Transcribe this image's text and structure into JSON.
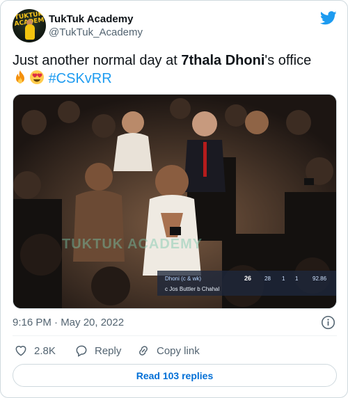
{
  "user": {
    "display_name": "TukTuk Academy",
    "handle": "@TukTuk_Academy",
    "avatar_text": "TUKTUK ACADEMY"
  },
  "tweet": {
    "text_prefix": "Just another normal day at ",
    "text_bold": "7thala Dhoni",
    "text_suffix": "'s office",
    "hashtag": "#CSKvRR",
    "emojis": [
      "fire-emoji",
      "heart-eyes-emoji"
    ]
  },
  "media": {
    "watermark": "TUKTUK ACADEMY",
    "scorecard": {
      "batter": "Dhoni (c & wk)",
      "runs": "26",
      "balls": "28",
      "fours": "1",
      "sixes": "1",
      "strike_rate": "92.86",
      "dismissal": "c Jos Buttler b Chahal"
    }
  },
  "meta": {
    "timestamp": "9:16 PM · May 20, 2022"
  },
  "actions": {
    "like_count": "2.8K",
    "reply_label": "Reply",
    "copy_link_label": "Copy link"
  },
  "read_replies_label": "Read 103 replies",
  "colors": {
    "accent": "#1d9bf0",
    "link_button": "#006fd6",
    "secondary_text": "#536471",
    "primary_text": "#0f1419"
  }
}
